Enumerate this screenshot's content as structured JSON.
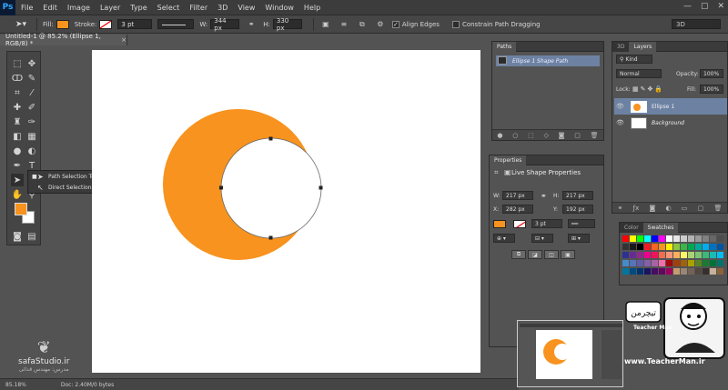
{
  "app": {
    "logo": "Ps"
  },
  "menu": [
    "File",
    "Edit",
    "Image",
    "Layer",
    "Type",
    "Select",
    "Filter",
    "3D",
    "View",
    "Window",
    "Help"
  ],
  "window_controls": [
    "—",
    "▢",
    "✕"
  ],
  "options": {
    "fill_label": "Fill:",
    "fill_color": "#f7931e",
    "stroke_label": "Stroke:",
    "stroke_size": "3 pt",
    "w_label": "W:",
    "w_value": "344 px",
    "h_label": "H:",
    "h_value": "330 px",
    "align_edges_label": "Align Edges",
    "constrain_label": "Constrain Path Dragging",
    "workspace": "3D"
  },
  "document": {
    "tab_title": "Untitled-1 @ 85.2% (Ellipse 1, RGB/8) *",
    "zoom": "85.18%",
    "doc_info": "Doc: 2.40M/0 bytes"
  },
  "flyout": {
    "items": [
      {
        "label": "Path Selection Tool",
        "shortcut": "A"
      },
      {
        "label": "Direct Selection Tool",
        "shortcut": "A"
      }
    ]
  },
  "colors": {
    "foreground": "#f7931e",
    "background": "#ffffff",
    "shape": "#f7931e"
  },
  "paths_panel": {
    "tab": "Paths",
    "row": "Ellipse 1 Shape Path"
  },
  "properties_panel": {
    "tab": "Properties",
    "title": "Live Shape Properties",
    "w_label": "W:",
    "w": "217 px",
    "h_label": "H:",
    "h": "217 px",
    "x_label": "X:",
    "x": "282 px",
    "y_label": "Y:",
    "y": "192 px",
    "stroke_size": "3 pt"
  },
  "layers_panel": {
    "tabs": [
      "3D",
      "Layers"
    ],
    "kind": "Kind",
    "blend": "Normal",
    "opacity_label": "Opacity:",
    "opacity": "100%",
    "lock_label": "Lock:",
    "fill_label": "Fill:",
    "fill": "100%",
    "layers": [
      {
        "name": "Ellipse 1",
        "selected": true
      },
      {
        "name": "Background",
        "selected": false
      }
    ]
  },
  "swatches_panel": {
    "tabs": [
      "Color",
      "Swatches"
    ]
  },
  "watermark": {
    "site": "safaStudio.ir",
    "sub": "مدرس: مهندس قدائی",
    "teacher_site": "www.TeacherMan.ir",
    "teacher_sub": "Teacher Man"
  }
}
